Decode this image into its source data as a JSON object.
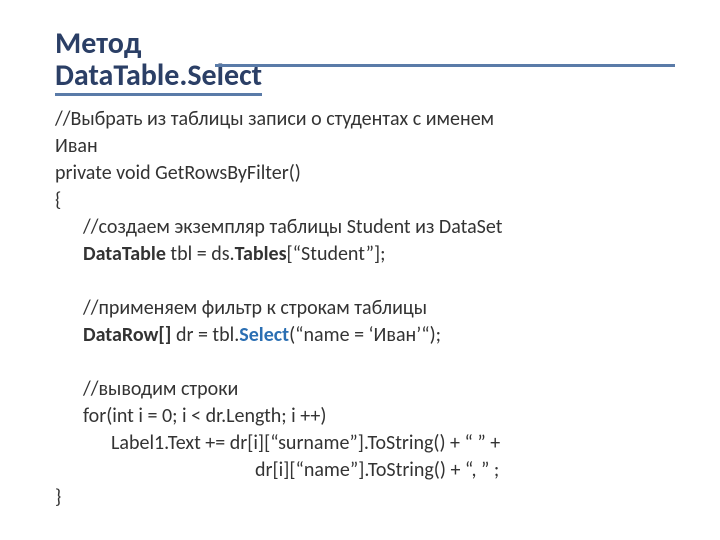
{
  "title": {
    "line1": "Метод",
    "line2": "DataTable.Select"
  },
  "code": {
    "c1a": "//Выбрать из таблицы записи о студентах с именем",
    "c1b": "Иван",
    "sig": "private void GetRowsByFilter()",
    "open": "{",
    "c2": "//создаем экземпляр таблицы Student из DataSet",
    "l1a": "DataTable",
    "l1b": "  tbl = ds.",
    "l1c": "Tables",
    "l1d": "[“Student”];",
    "c3": "//применяем фильтр к строкам таблицы",
    "l2a": "DataRow[]",
    "l2b": "  dr = tbl.",
    "l2c": "Select",
    "l2d": "(“name = ‘Иван’“);",
    "c4": "//выводим строки",
    "l3": "for(int i = 0; i < dr.Length; i ++)",
    "l4": "Label1.Text += dr[i][“surname”].ToString() + “  ” +",
    "l5": "dr[i][“name”].ToString() + “, ” ;",
    "close": "}"
  }
}
